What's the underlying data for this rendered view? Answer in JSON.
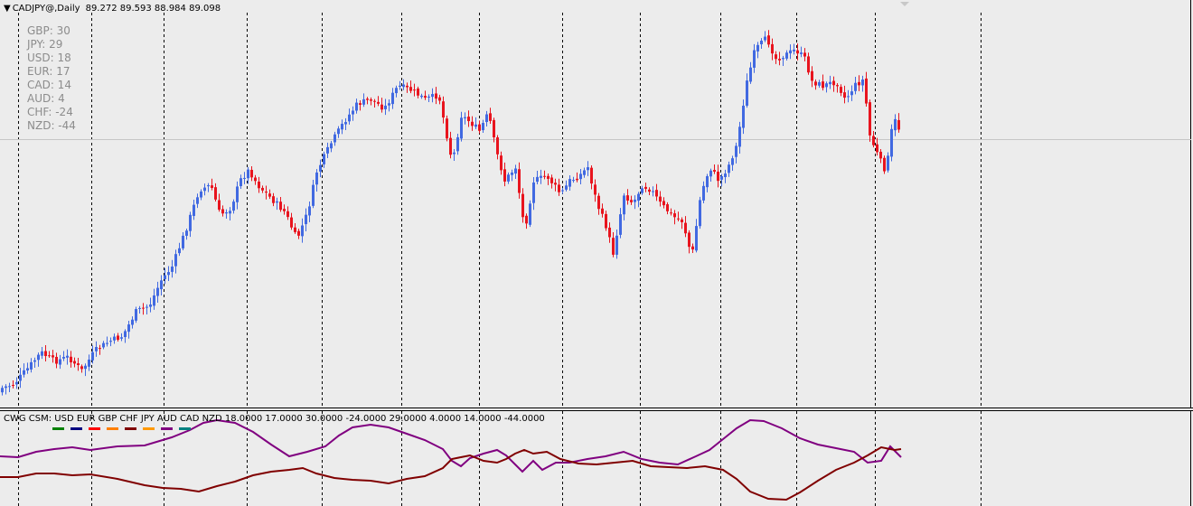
{
  "main": {
    "symbol": "CADJPY@,Daily",
    "ohlc": "89.272 89.593 88.984 89.098",
    "up_color": "#4169e1",
    "down_color": "#e8141e",
    "grid_color": "#000000",
    "currency_strengths": [
      {
        "label": "GBP: 30"
      },
      {
        "label": "JPY: 29"
      },
      {
        "label": "USD: 18"
      },
      {
        "label": "EUR: 17"
      },
      {
        "label": "CAD: 14"
      },
      {
        "label": "AUD: 4"
      },
      {
        "label": "CHF: -24"
      },
      {
        "label": "NZD: -44"
      }
    ]
  },
  "indicator": {
    "title": "CWG CSM: USD EUR GBP CHF JPY AUD CAD NZD 18.0000 17.0000 30.0000 -24.0000 29.0000 4.0000 14.0000 -44.0000",
    "legend_colors": [
      "#008000",
      "#000080",
      "#ff0000",
      "#ff7f00",
      "#800000",
      "#ff9900",
      "#800080",
      "#008080"
    ],
    "line1_color": "#800080",
    "line2_color": "#800000"
  },
  "chart_data": {
    "type": "candlestick",
    "symbol": "CADJPY@",
    "timeframe": "Daily",
    "last_ohlc": {
      "open": 89.272,
      "high": 89.593,
      "low": 88.984,
      "close": 89.098
    },
    "indicator_last_values": {
      "USD": 18,
      "EUR": 17,
      "GBP": 30,
      "CHF": -24,
      "JPY": 29,
      "AUD": 4,
      "CAD": 14,
      "NZD": -44
    }
  }
}
